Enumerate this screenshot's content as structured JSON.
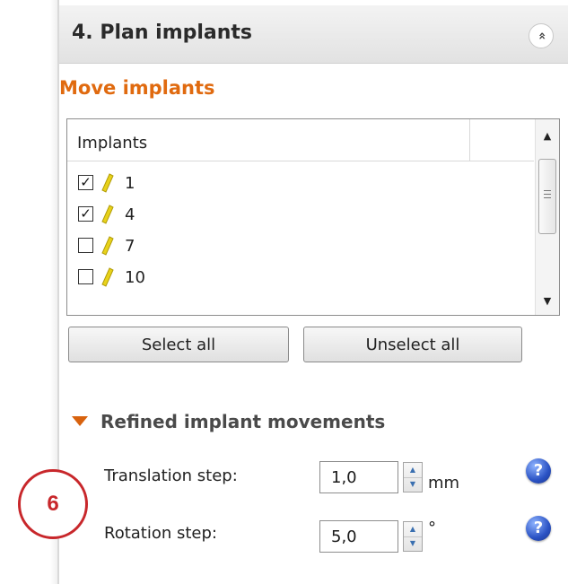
{
  "panel": {
    "header_title": "4. Plan implants",
    "collapse_glyph": "«"
  },
  "move_section": {
    "title": "Move implants",
    "list_header": "Implants",
    "implants": [
      {
        "label": "1",
        "checked": true
      },
      {
        "label": "4",
        "checked": true
      },
      {
        "label": "7",
        "checked": false
      },
      {
        "label": "10",
        "checked": false
      }
    ],
    "select_all_label": "Select all",
    "unselect_all_label": "Unselect all"
  },
  "refined_section": {
    "title": "Refined implant movements",
    "translation": {
      "label": "Translation step:",
      "value": "1,0",
      "unit": "mm"
    },
    "rotation": {
      "label": "Rotation step:",
      "value": "5,0",
      "unit": "°"
    }
  },
  "callout": {
    "number": "6"
  },
  "colors": {
    "section_title": "#e06a0f",
    "callout": "#c8272b",
    "implant_icon": "#e8d21a"
  },
  "icons": [
    "collapse-up-icon",
    "implant-icon",
    "scroll-up-icon",
    "scroll-down-icon",
    "expand-arrow-icon",
    "help-icon",
    "spinner-up-icon",
    "spinner-down-icon"
  ]
}
